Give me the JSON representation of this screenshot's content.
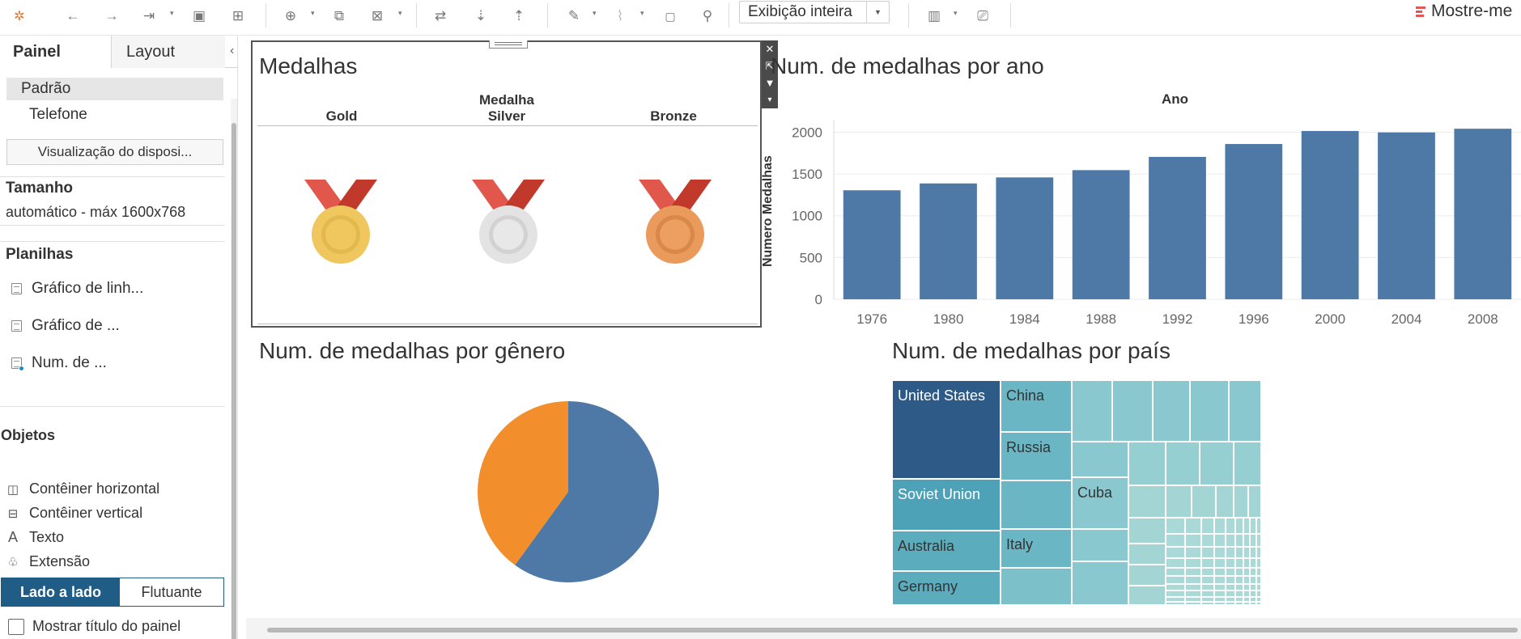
{
  "toolbar": {
    "view_select": "Exibição inteira",
    "show_me": "Mostre-me"
  },
  "left_panel": {
    "tabs": [
      {
        "label": "Painel",
        "active": true
      },
      {
        "label": "Layout",
        "active": false
      }
    ],
    "devices": [
      {
        "label": "Padrão",
        "selected": true
      },
      {
        "label": "Telefone",
        "selected": false
      }
    ],
    "device_preview_button": "Visualização do disposi...",
    "size_heading": "Tamanho",
    "size_value": "automático - máx 1600x768",
    "sheets_heading": "Planilhas",
    "sheets": [
      {
        "label": "Gráfico de linh..."
      },
      {
        "label": "Gráfico de ..."
      },
      {
        "label": "Num. de ..."
      }
    ],
    "objects_heading": "Objetos",
    "objects": [
      {
        "label": "Contêiner horizontal",
        "icon": "horizontal-container-icon"
      },
      {
        "label": "Contêiner vertical",
        "icon": "vertical-container-icon"
      },
      {
        "label": "Texto",
        "icon": "text-icon"
      },
      {
        "label": "Extensão",
        "icon": "extension-icon"
      }
    ],
    "layout_toggle": {
      "tiled": "Lado a lado",
      "floating": "Flutuante",
      "selected": "Lado a lado"
    },
    "show_title_checkbox": {
      "label": "Mostrar título do painel",
      "checked": false
    }
  },
  "dashboard": {
    "medals": {
      "title": "Medalhas",
      "header_field": "Medalha",
      "columns": [
        {
          "label": "Gold",
          "ribbon": "#d84c3c",
          "color": "#efc75e",
          "inner": "#e3b94d"
        },
        {
          "label": "Silver",
          "ribbon": "#d84c3c",
          "color": "#e3e3e3",
          "inner": "#d2d2d2"
        },
        {
          "label": "Bronze",
          "ribbon": "#d84c3c",
          "color": "#ea9a5b",
          "inner": "#d9874a"
        }
      ]
    },
    "by_year": {
      "title": "Num. de medalhas por ano"
    },
    "by_gender": {
      "title": "Num. de medalhas por gênero"
    },
    "by_country": {
      "title": "Num. de medalhas por país"
    }
  },
  "chart_data": [
    {
      "type": "bar",
      "title": "Num. de medalhas por ano",
      "xlabel": "Ano",
      "ylabel": "Numero Medalhas",
      "categories": [
        "1976",
        "1980",
        "1984",
        "1988",
        "1992",
        "1996",
        "2000",
        "2004",
        "2008"
      ],
      "values": [
        1305,
        1387,
        1459,
        1546,
        1705,
        1859,
        2015,
        1998,
        2042
      ],
      "ylim": [
        0,
        2150
      ],
      "yticks": [
        0,
        500,
        1000,
        1500,
        2000
      ],
      "color": "#4e79a7",
      "grid": true
    },
    {
      "type": "pie",
      "title": "Num. de medalhas por gênero",
      "slices": [
        {
          "value": 60,
          "color": "#4e79a7"
        },
        {
          "value": 40,
          "color": "#f28e2b"
        }
      ]
    },
    {
      "type": "treemap",
      "title": "Num. de medalhas por país",
      "labels": [
        "United States",
        "China",
        "Russia",
        "Soviet Union",
        "Cuba",
        "Australia",
        "Italy",
        "Germany"
      ]
    }
  ]
}
